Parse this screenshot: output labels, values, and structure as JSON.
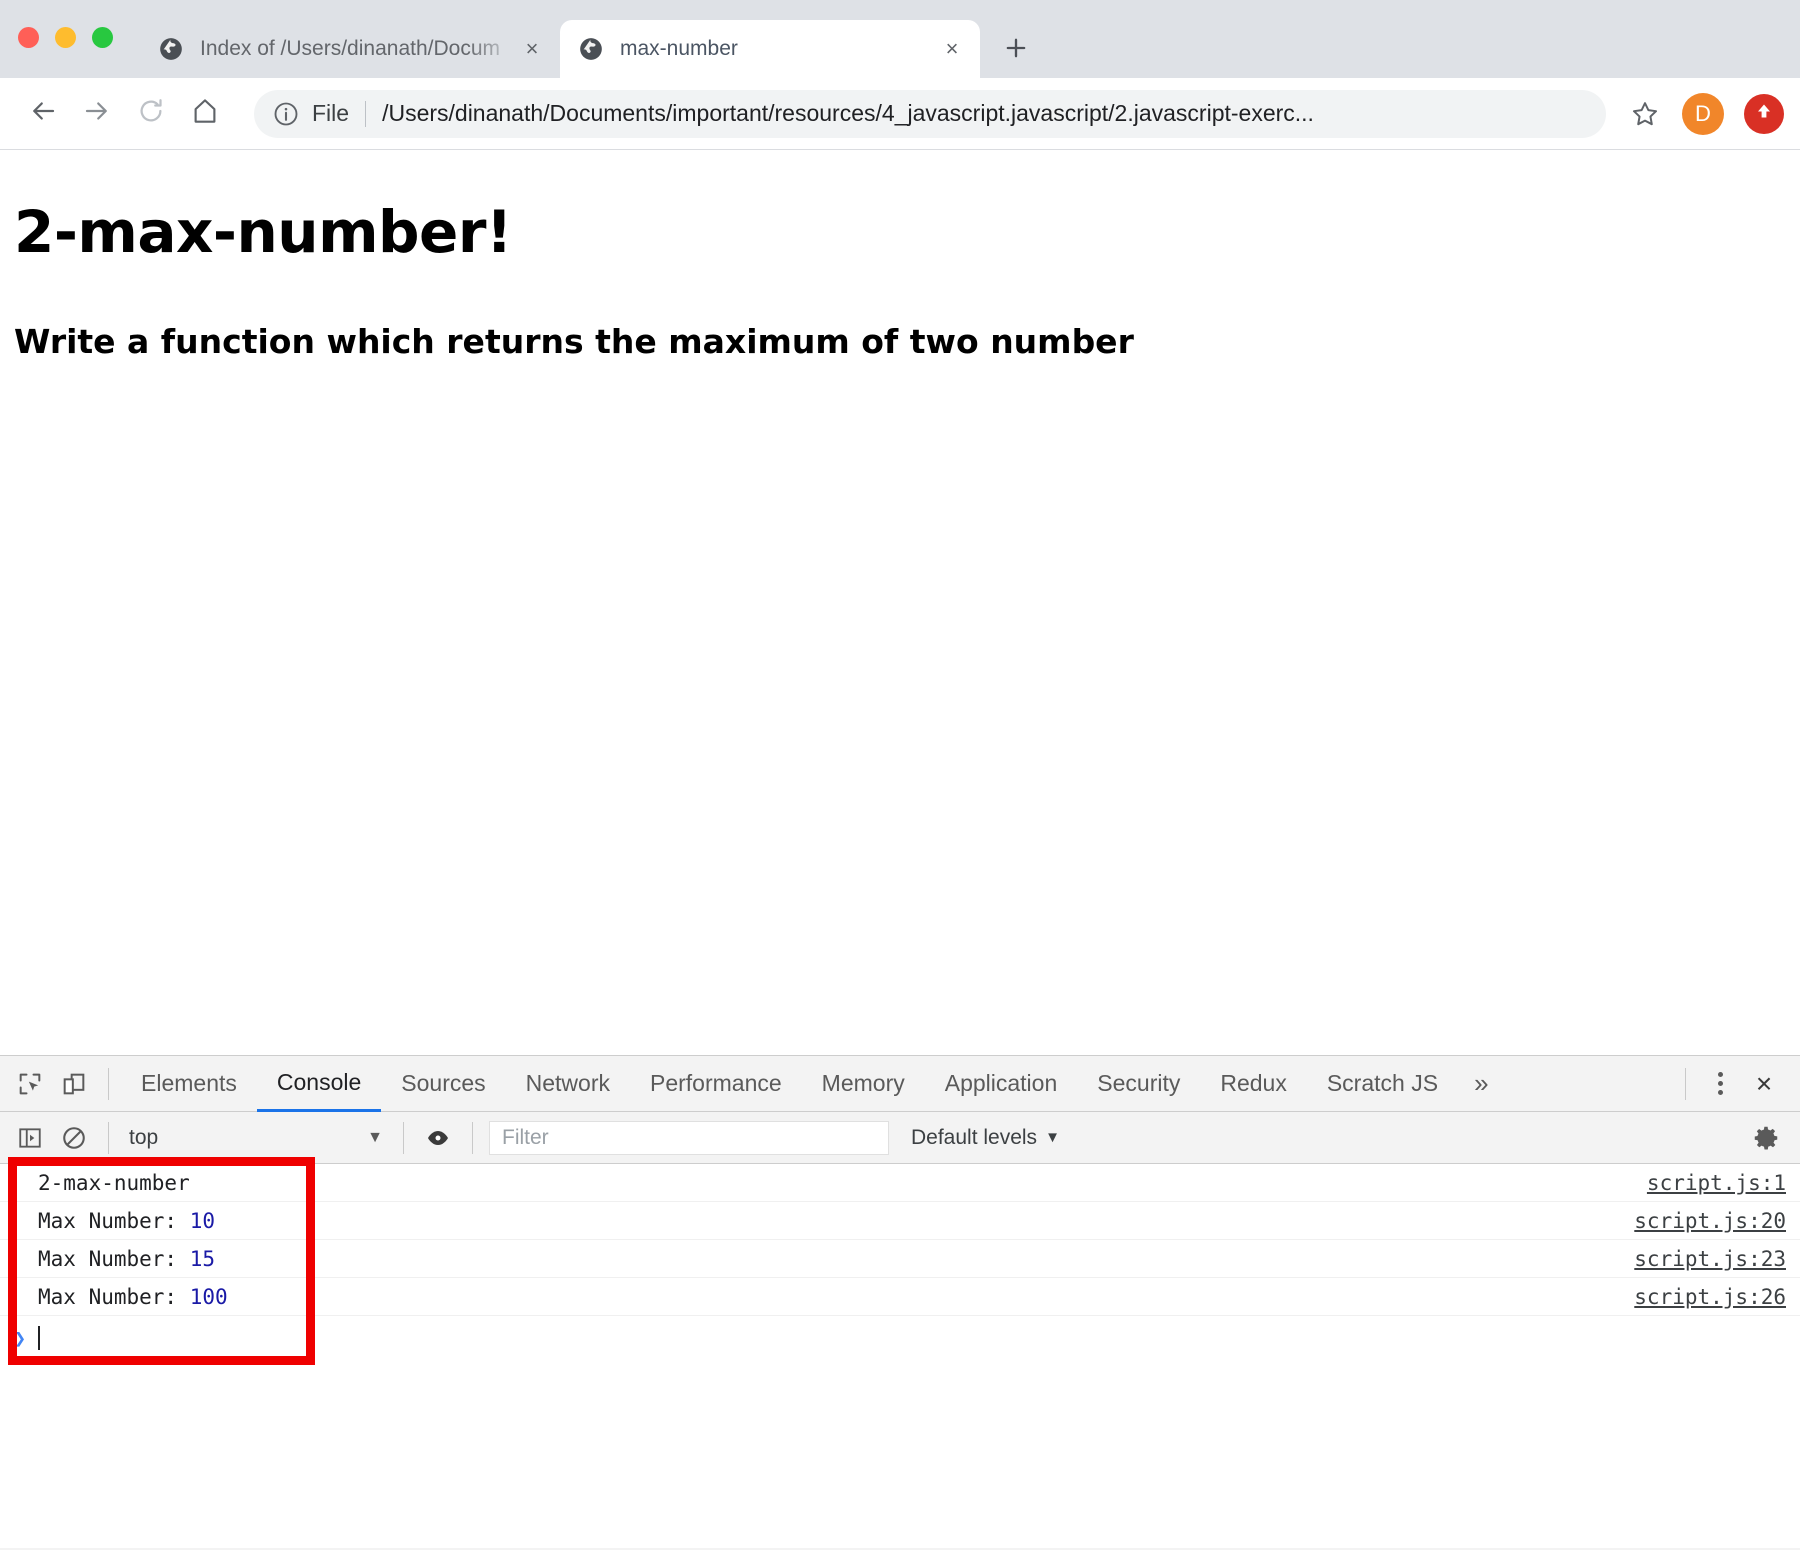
{
  "window": {
    "traffic_lights": [
      "close",
      "minimize",
      "maximize"
    ]
  },
  "tabs": [
    {
      "title": "Index of /Users/dinanath/Docum",
      "favicon": "globe-icon",
      "active": false,
      "close_label": "×"
    },
    {
      "title": "max-number",
      "favicon": "globe-icon",
      "active": true,
      "close_label": "×"
    }
  ],
  "new_tab_label": "+",
  "toolbar": {
    "back_icon": "arrow-left-icon",
    "forward_icon": "arrow-right-icon",
    "reload_icon": "reload-icon",
    "home_icon": "home-icon",
    "omnibox": {
      "info_icon": "info-circle-icon",
      "scheme": "File",
      "url": "/Users/dinanath/Documents/important/resources/4_javascript.javascript/2.javascript-exerc...",
      "star_icon": "star-icon"
    },
    "avatar_letter": "D",
    "avatar_color": "#f1862a",
    "update_color": "#d93025",
    "update_icon": "arrow-up-icon"
  },
  "page": {
    "heading": "2-max-number!",
    "subheading": "Write a function which returns the maximum of two number"
  },
  "devtools": {
    "inspect_icon": "inspect-cursor-icon",
    "device_icon": "device-toolbar-icon",
    "tabs": [
      {
        "label": "Elements",
        "active": false
      },
      {
        "label": "Console",
        "active": true
      },
      {
        "label": "Sources",
        "active": false
      },
      {
        "label": "Network",
        "active": false
      },
      {
        "label": "Performance",
        "active": false
      },
      {
        "label": "Memory",
        "active": false
      },
      {
        "label": "Application",
        "active": false
      },
      {
        "label": "Security",
        "active": false
      },
      {
        "label": "Redux",
        "active": false
      },
      {
        "label": "Scratch JS",
        "active": false
      }
    ],
    "more_tabs_label": "»",
    "kebab_icon": "kebab-menu-icon",
    "close_label": "×",
    "console_toolbar": {
      "sidebar_icon": "console-sidebar-icon",
      "clear_icon": "clear-console-icon",
      "context": "top",
      "context_caret": "▼",
      "eye_icon": "live-expression-icon",
      "filter_placeholder": "Filter",
      "filter_value": "",
      "levels_label": "Default levels",
      "levels_caret": "▼",
      "gear_icon": "settings-gear-icon"
    },
    "console_messages": [
      {
        "text": "2-max-number",
        "label": "",
        "value": "",
        "source": "script.js:1"
      },
      {
        "text": "",
        "label": "Max Number: ",
        "value": "10",
        "source": "script.js:20"
      },
      {
        "text": "",
        "label": "Max Number: ",
        "value": "15",
        "source": "script.js:23"
      },
      {
        "text": "",
        "label": "Max Number: ",
        "value": "100",
        "source": "script.js:26"
      }
    ],
    "prompt": {
      "arrow": "❯",
      "value": ""
    },
    "annotation_color": "#ef0000"
  }
}
